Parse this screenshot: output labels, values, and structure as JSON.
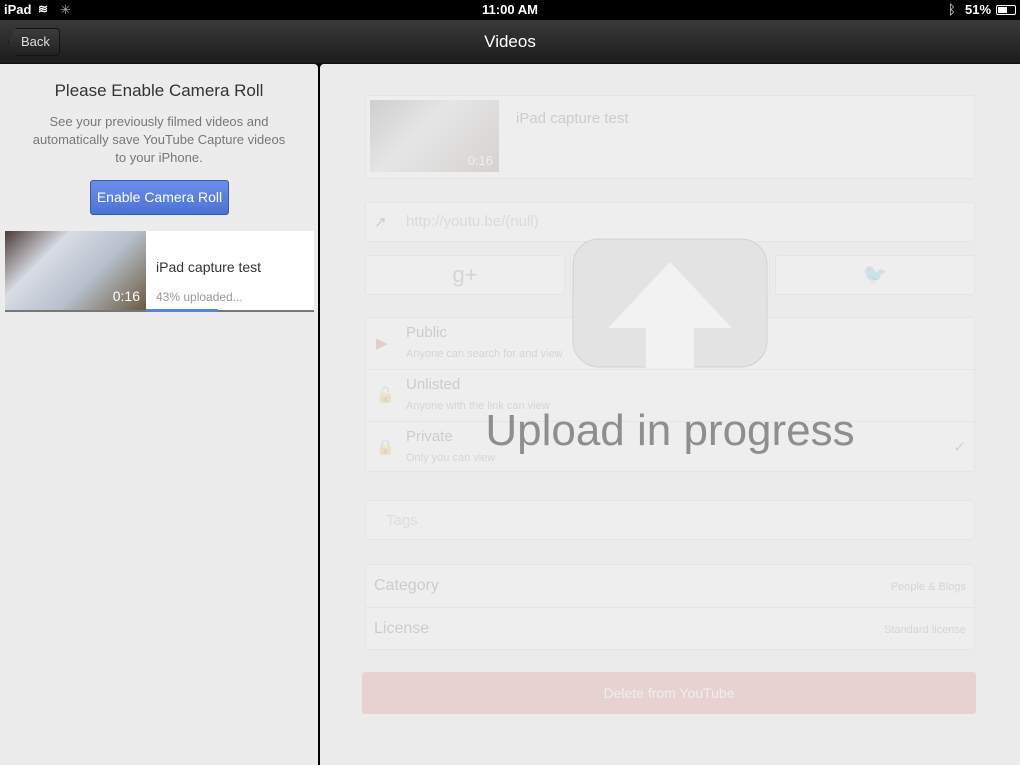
{
  "status": {
    "device": "iPad",
    "time": "11:00 AM",
    "battery": "51%",
    "icons": [
      "wifi-icon",
      "activity-spinner-icon",
      "bluetooth-icon",
      "battery-icon"
    ]
  },
  "nav": {
    "back": "Back",
    "title": "Videos"
  },
  "left": {
    "heading": "Please Enable Camera Roll",
    "desc": "See your previously filmed videos and automatically save YouTube Capture videos to your iPhone.",
    "enable": "Enable Camera Roll",
    "video": {
      "title": "iPad capture test",
      "duration": "0:16",
      "progress_text": "43% uploaded...",
      "progress": 0.43
    }
  },
  "detail": {
    "title": "iPad capture test",
    "duration": "0:16",
    "url": "http://youtu.be/(null)",
    "privacy": [
      {
        "label": "Public",
        "desc": "Anyone can search for and view"
      },
      {
        "label": "Unlisted",
        "desc": "Anyone with the link can view"
      },
      {
        "label": "Private",
        "desc": "Only you can view",
        "checked": true
      }
    ],
    "tags_placeholder": "Tags",
    "category_label": "Category",
    "category_value": "People & Blogs",
    "license_label": "License",
    "license_value": "Standard license",
    "delete": "Delete from YouTube"
  },
  "overlay": {
    "text": "Upload in progress",
    "icon": "upload-arrow-icon"
  },
  "colors": {
    "accent": "#5b82e0",
    "delete": "#d9534f"
  }
}
